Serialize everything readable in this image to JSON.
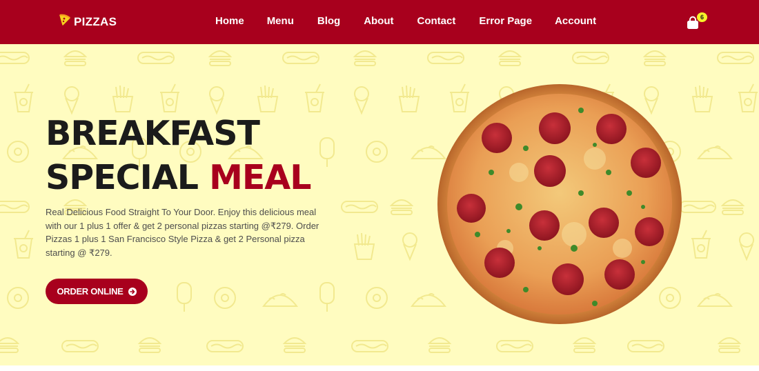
{
  "brand": {
    "name": "PIZZAS",
    "icon": "pizza-slice-icon"
  },
  "nav": {
    "items": [
      {
        "label": "Home"
      },
      {
        "label": "Menu"
      },
      {
        "label": "Blog"
      },
      {
        "label": "About"
      },
      {
        "label": "Contact"
      },
      {
        "label": "Error Page"
      },
      {
        "label": "Account"
      }
    ]
  },
  "cart": {
    "icon": "shopping-bag-icon",
    "count": "6"
  },
  "hero": {
    "headline_line1": "BREAKFAST",
    "headline_line2_prefix": "SPECIAL",
    "headline_line2_accent": "MEAL",
    "description": "Real Delicious Food Straight To Your Door. Enjoy this delicious meal with our 1 plus 1 offer & get 2 personal pizzas starting @₹279. Order Pizzas 1 plus 1 San Francisco Style Pizza & get 2 Personal pizza starting @ ₹279.",
    "cta_label": "ORDER ONLINE",
    "cta_icon": "arrow-right-circle-icon",
    "image": "pepperoni-pizza-image"
  },
  "colors": {
    "primary": "#a8001d",
    "hero_background": "#fffcc0",
    "badge": "#f6f22a",
    "pattern": "#f2e98f"
  }
}
